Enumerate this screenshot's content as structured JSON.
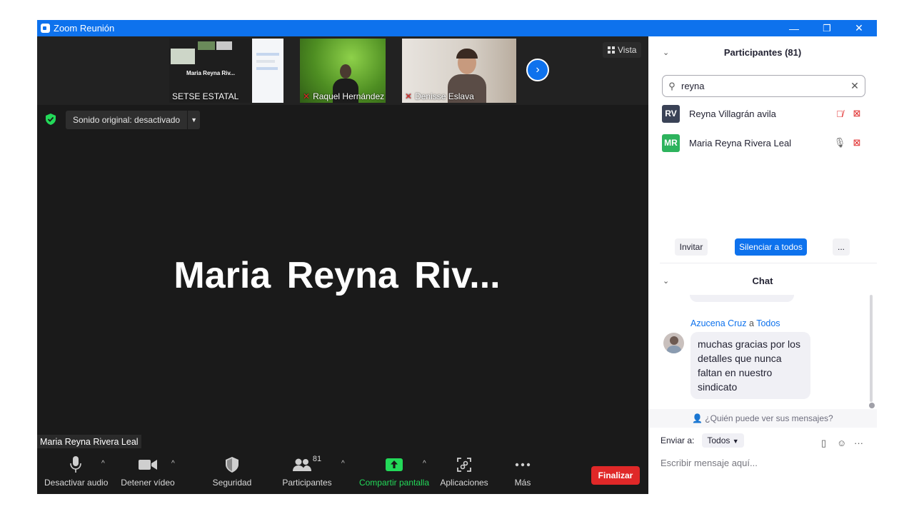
{
  "window": {
    "title": "Zoom Reunión",
    "minimize": "—",
    "restore": "❐",
    "close": "✕"
  },
  "video": {
    "thumbnails": [
      {
        "name": "SETSE ESTATAL",
        "inner_label": "Maria Reyna Riv...",
        "muted": false
      },
      {
        "name": "Raquel Hernández",
        "muted": true
      },
      {
        "name": "Denisse Eslava",
        "muted": true
      }
    ],
    "next_arrow": "›",
    "view_button": "Vista",
    "original_sound": "Sonido original: desactivado",
    "active_speaker_big": "Maria Reyna Riv...",
    "active_speaker_tag": "Maria Reyna Rivera Leal"
  },
  "toolbar": {
    "mute": "Desactivar audio",
    "stop_video": "Detener vídeo",
    "security": "Seguridad",
    "participants": "Participantes",
    "participants_count": "81",
    "share": "Compartir pantalla",
    "apps": "Aplicaciones",
    "more": "Más",
    "end": "Finalizar"
  },
  "participants_panel": {
    "header": "Participantes (81)",
    "search_value": "reyna",
    "list": [
      {
        "initials": "RV",
        "name": "Reyna Villagrán avila",
        "color": "#3a4256"
      },
      {
        "initials": "MR",
        "name": "Maria Reyna Rivera Leal",
        "color": "#2db35d"
      }
    ],
    "invite": "Invitar",
    "mute_all": "Silenciar a todos",
    "more": "..."
  },
  "chat": {
    "header": "Chat",
    "message": {
      "sender": "Azucena Cruz",
      "connector": " a ",
      "recipient": "Todos",
      "text": "muchas gracias por los detalles que nunca faltan en nuestro sindicato"
    },
    "who_can_see": "¿Quién puede ver sus mensajes?",
    "send_to_label": "Enviar a:",
    "send_to_value": "Todos",
    "input_placeholder": "Escribir mensaje aquí..."
  },
  "colors": {
    "zoom_blue": "#0e72ed",
    "end_red": "#e02828",
    "share_green": "#23d959",
    "dark_bg": "#1a1a1a"
  }
}
